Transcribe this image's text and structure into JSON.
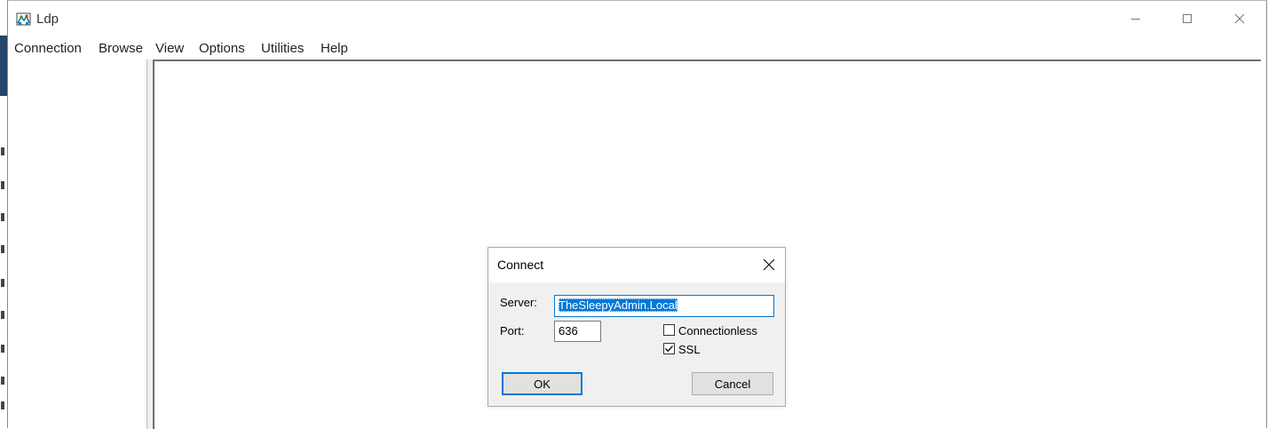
{
  "window": {
    "title": "Ldp",
    "controls": [
      "minimize-icon",
      "maximize-icon",
      "close-icon"
    ]
  },
  "menu": {
    "items": [
      "Connection",
      "Browse",
      "View",
      "Options",
      "Utilities",
      "Help"
    ]
  },
  "dialog": {
    "title": "Connect",
    "server_label": "Server:",
    "server_value": "TheSleepyAdmin.Local",
    "port_label": "Port:",
    "port_value": "636",
    "connectionless_label": "Connectionless",
    "connectionless_checked": false,
    "ssl_label": "SSL",
    "ssl_checked": true,
    "ok_label": "OK",
    "cancel_label": "Cancel"
  },
  "colors": {
    "accent": "#0078d7",
    "dialog_bg": "#f0f0f0",
    "button_bg": "#e1e1e1"
  }
}
